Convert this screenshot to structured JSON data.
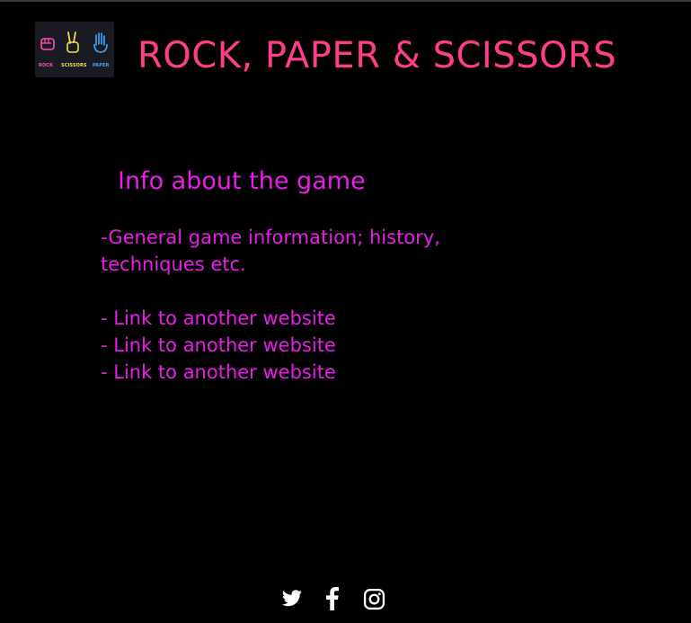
{
  "header": {
    "title": "ROCK, PAPER & SCISSORS",
    "logo": {
      "labels": [
        "ROCK",
        "SCISSORS",
        "PAPER"
      ],
      "colors": [
        "#ff4fb3",
        "#f2e14a",
        "#3aa8ff"
      ],
      "icons": [
        "fist-icon",
        "peace-hand-icon",
        "open-hand-icon"
      ]
    }
  },
  "info": {
    "heading": "Info about the game",
    "description_line1": "-General game information; history,",
    "description_line2": "techniques etc.",
    "links": [
      "- Link to another website",
      "- Link to another website",
      "- Link to another website"
    ]
  },
  "footer": {
    "social_icons": [
      "twitter-icon",
      "facebook-icon",
      "instagram-icon"
    ]
  },
  "colors": {
    "background": "#000000",
    "title": "#ff3d8a",
    "content": "#e81ee8",
    "icons": "#ffffff"
  }
}
